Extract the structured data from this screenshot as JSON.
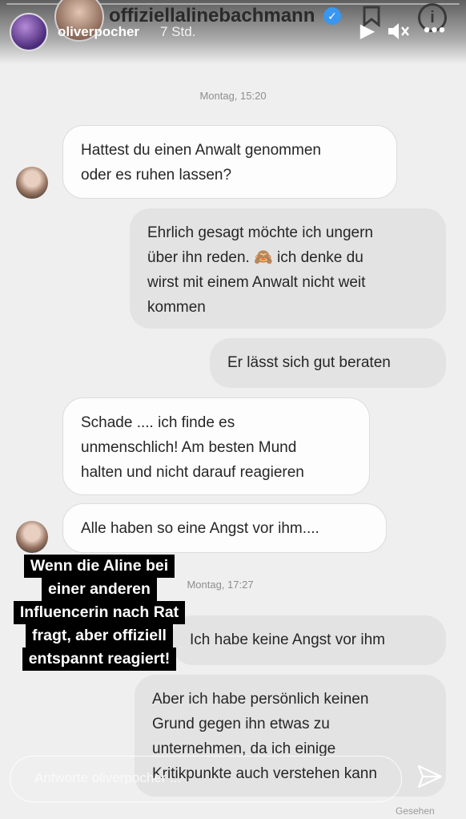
{
  "story": {
    "poster_name": "oliverpocher",
    "posted_ago": "7 Std.",
    "dm_name": "offiziellalinebachmann"
  },
  "chat": {
    "timestamp_1": "Montag, 15:20",
    "timestamp_2": "Montag, 17:27",
    "messages": [
      {
        "from": "other",
        "text": "Hattest du einen Anwalt genommen\noder es ruhen lassen?"
      },
      {
        "from": "me",
        "text": "Ehrlich gesagt möchte ich ungern\nüber ihn reden. 🙈 ich denke du\nwirst mit einem Anwalt nicht weit\nkommen"
      },
      {
        "from": "me",
        "text": "Er lässt sich gut beraten"
      },
      {
        "from": "other",
        "text": "Schade .... ich finde es\nunmenschlich! Am besten Mund\nhalten und nicht darauf reagieren"
      },
      {
        "from": "other",
        "text": "Alle haben so eine Angst vor ihm...."
      },
      {
        "from": "me",
        "text": "Ich habe keine Angst vor ihm"
      },
      {
        "from": "me",
        "text": "Aber ich habe persönlich keinen\nGrund gegen ihn etwas zu\nunternehmen, da ich einige\nKritikpunkte auch verstehen kann"
      }
    ],
    "seen_label": "Gesehen"
  },
  "caption": {
    "lines": [
      "Wenn die Aline bei",
      "einer anderen",
      "Influencerin nach Rat",
      "fragt, aber offiziell",
      "entspannt reagiert!"
    ]
  },
  "reply": {
    "placeholder": "Antworte oliverpocher ..."
  },
  "icons": {
    "verified": "verified-badge-icon",
    "flag": "flag-icon",
    "info": "info-icon",
    "play": "play-icon",
    "mute": "mute-icon",
    "more": "more-icon",
    "send": "send-icon"
  },
  "colors": {
    "verified_blue": "#3897f0",
    "caption_bg": "#000000"
  }
}
